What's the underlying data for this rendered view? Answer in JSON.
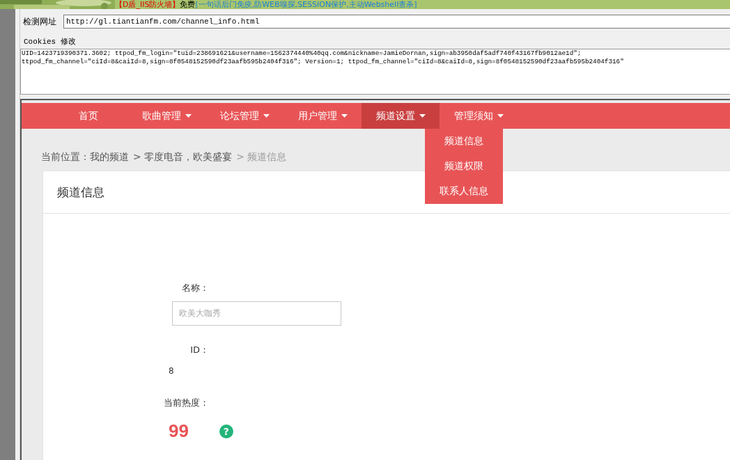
{
  "banner": {
    "brand": "【D盾_IIS防火墙】",
    "free": "免费",
    "features": "[一句话后门免疫,防WEB嗅探,SESSION保护,主动Webshell查杀]"
  },
  "tool": {
    "url_label": "检测网址",
    "url": "http://gl.tiantianfm.com/channel_info.html",
    "cookies_label": "Cookies 修改",
    "cookies_lines": [
      "UID=1423719390371.3602; ttpod_fm_login=\"tuid=238691621&username=1562374440%40qq.com&nickname=JamieDornan,sign=ab3950daf5adf740f43167fb9012ae1d\";",
      "ttpod_fm_channel=\"ciId=8&caiId=8,sign=8f0548152590df23aafb595b2404f316\"; Version=1; ttpod_fm_channel=\"ciId=8&caiId=8,sign=8f0548152590df23aafb595b2404f316\""
    ]
  },
  "nav": [
    {
      "label": "首页",
      "dropdown": false,
      "selected": false
    },
    {
      "label": "歌曲管理",
      "dropdown": true,
      "selected": false
    },
    {
      "label": "论坛管理",
      "dropdown": true,
      "selected": false
    },
    {
      "label": "用户管理",
      "dropdown": true,
      "selected": false
    },
    {
      "label": "频道设置",
      "dropdown": true,
      "selected": true,
      "menu": [
        "频道信息",
        "频道权限",
        "联系人信息"
      ]
    },
    {
      "label": "管理须知",
      "dropdown": true,
      "selected": false
    }
  ],
  "breadcrumb": [
    {
      "label": "当前位置：我的频道",
      "current": false
    },
    {
      "label": "> 零度电音，欧美盛宴",
      "current": false
    },
    {
      "label": "> 频道信息",
      "current": true
    }
  ],
  "card": {
    "title": "频道信息",
    "name_label": "名称：",
    "name_value": "欧美大咖秀",
    "id_label": "ID：",
    "id_value": "8",
    "heat_label": "当前热度：",
    "heat_value": "99",
    "help": "?"
  }
}
